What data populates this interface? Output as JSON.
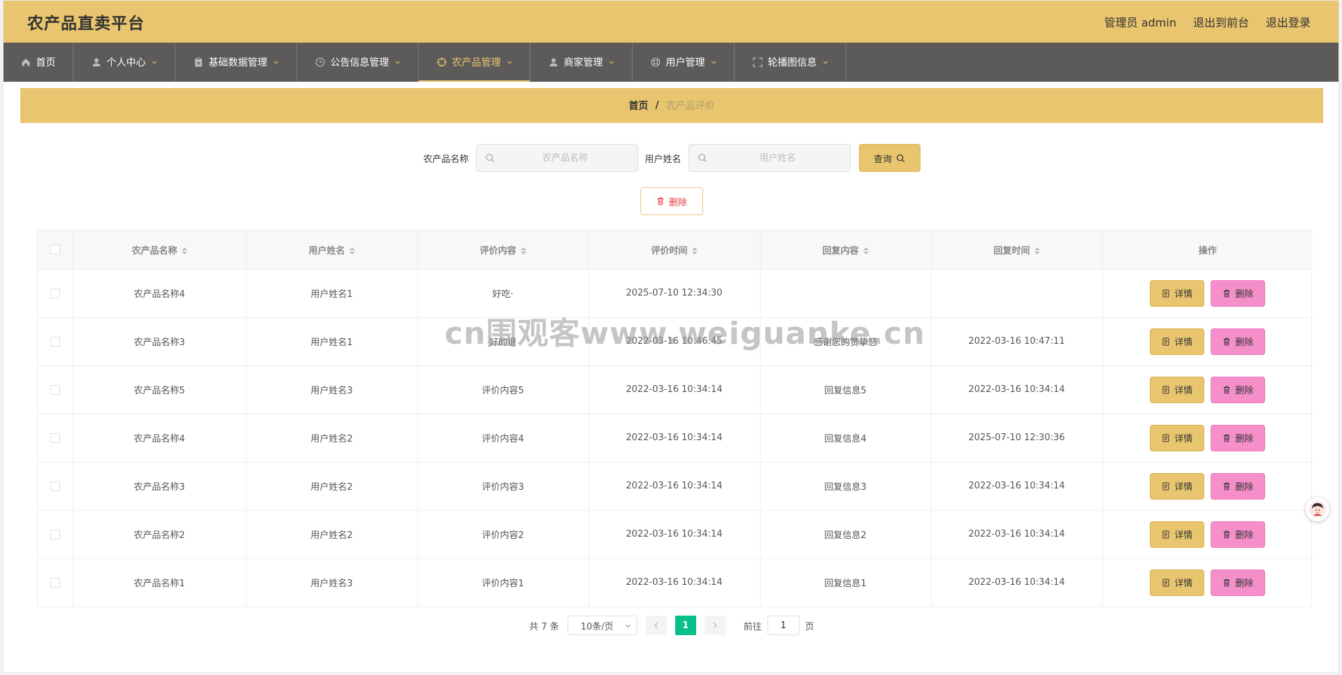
{
  "header": {
    "brand": "农产品直卖平台",
    "admin_label": "管理员 admin",
    "to_front": "退出到前台",
    "logout": "退出登录"
  },
  "nav": [
    {
      "label": "首页",
      "icon": "home-icon",
      "has_caret": false,
      "active": false,
      "width": 100
    },
    {
      "label": "个人中心",
      "icon": "user-icon",
      "has_caret": true,
      "active": false,
      "width": 146
    },
    {
      "label": "基础数据管理",
      "icon": "clipboard-icon",
      "has_caret": true,
      "active": false,
      "width": 174
    },
    {
      "label": "公告信息管理",
      "icon": "clock-icon",
      "has_caret": true,
      "active": false,
      "width": 174
    },
    {
      "label": "农产品管理",
      "icon": "crosshair-icon",
      "has_caret": true,
      "active": true,
      "width": 160
    },
    {
      "label": "商家管理",
      "icon": "user-icon",
      "has_caret": true,
      "active": false,
      "width": 146
    },
    {
      "label": "用户管理",
      "icon": "lifebuoy-icon",
      "has_caret": true,
      "active": false,
      "width": 146
    },
    {
      "label": "轮播图信息",
      "icon": "fullscreen-icon",
      "has_caret": true,
      "active": false,
      "width": 160
    }
  ],
  "breadcrumb": {
    "home": "首页",
    "separator": "/",
    "current": "农产品评价"
  },
  "search": {
    "product_label": "农产品名称",
    "product_placeholder": "农产品名称",
    "user_label": "用户姓名",
    "user_placeholder": "用户姓名",
    "query_label": "查询"
  },
  "bulk_delete_label": "删除",
  "table": {
    "columns": [
      "农产品名称",
      "用户姓名",
      "评价内容",
      "评价时间",
      "回复内容",
      "回复时间",
      "操作"
    ],
    "detail_label": "详情",
    "delete_label": "删除",
    "rows": [
      {
        "product": "农产品名称4",
        "user": "用户姓名1",
        "content": "好吃·",
        "time": "2025-07-10 12:34:30",
        "reply": "",
        "reply_time": ""
      },
      {
        "product": "农产品名称3",
        "user": "用户姓名1",
        "content": "好的很",
        "time": "2022-03-16 10:46:45",
        "reply": "感谢您的赞挚怒",
        "reply_time": "2022-03-16 10:47:11"
      },
      {
        "product": "农产品名称5",
        "user": "用户姓名3",
        "content": "评价内容5",
        "time": "2022-03-16 10:34:14",
        "reply": "回复信息5",
        "reply_time": "2022-03-16 10:34:14"
      },
      {
        "product": "农产品名称4",
        "user": "用户姓名2",
        "content": "评价内容4",
        "time": "2022-03-16 10:34:14",
        "reply": "回复信息4",
        "reply_time": "2025-07-10 12:30:36"
      },
      {
        "product": "农产品名称3",
        "user": "用户姓名2",
        "content": "评价内容3",
        "time": "2022-03-16 10:34:14",
        "reply": "回复信息3",
        "reply_time": "2022-03-16 10:34:14"
      },
      {
        "product": "农产品名称2",
        "user": "用户姓名2",
        "content": "评价内容2",
        "time": "2022-03-16 10:34:14",
        "reply": "回复信息2",
        "reply_time": "2022-03-16 10:34:14"
      },
      {
        "product": "农产品名称1",
        "user": "用户姓名3",
        "content": "评价内容1",
        "time": "2022-03-16 10:34:14",
        "reply": "回复信息1",
        "reply_time": "2022-03-16 10:34:14"
      }
    ]
  },
  "pagination": {
    "total": "共 7 条",
    "page_size": "10条/页",
    "current_page": "1",
    "goto_prefix": "前往",
    "goto_value": "1",
    "goto_suffix": "页"
  },
  "watermark": "cn围观客www.weiguanke.cn",
  "colors": {
    "accent": "#e8c56e",
    "nav_bg": "#5d5b5a",
    "delete_pink": "#f58fc9",
    "page_active": "#0bbf8a"
  }
}
